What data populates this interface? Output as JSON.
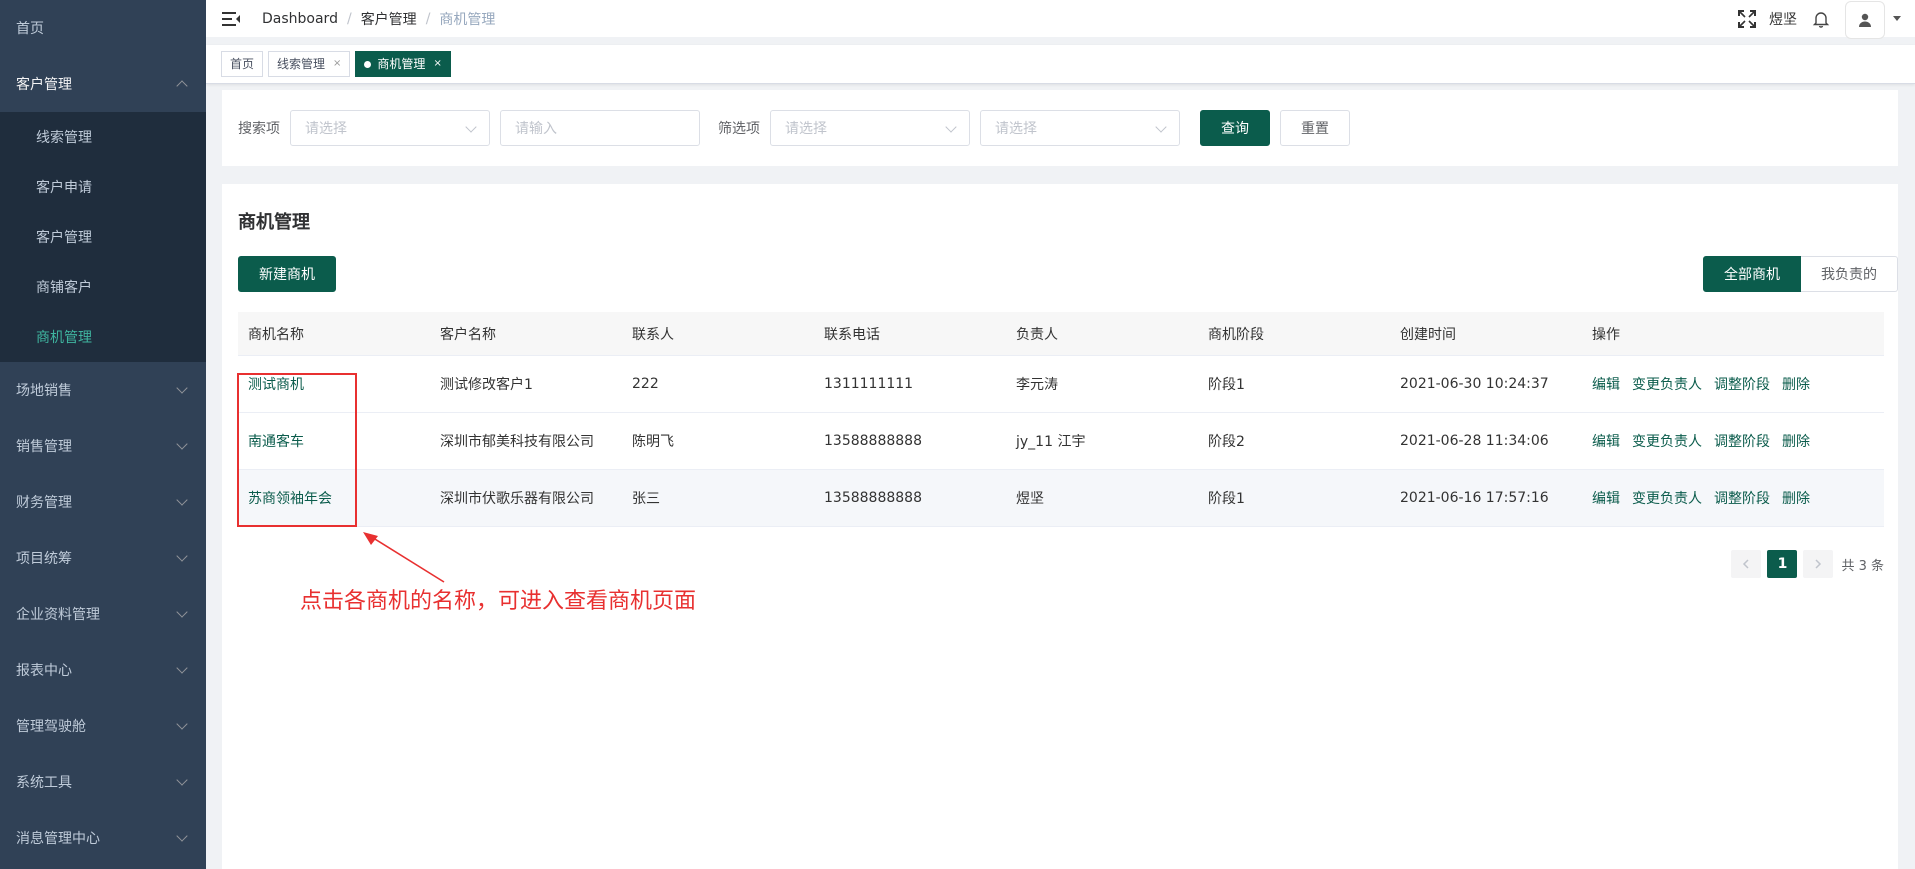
{
  "sidebar": {
    "items": [
      {
        "label": "首页"
      },
      {
        "label": "客户管理"
      },
      {
        "label": "场地销售"
      },
      {
        "label": "销售管理"
      },
      {
        "label": "财务管理"
      },
      {
        "label": "项目统筹"
      },
      {
        "label": "企业资料管理"
      },
      {
        "label": "报表中心"
      },
      {
        "label": "管理驾驶舱"
      },
      {
        "label": "系统工具"
      },
      {
        "label": "消息管理中心"
      }
    ],
    "sub_items": [
      {
        "label": "线索管理"
      },
      {
        "label": "客户申请"
      },
      {
        "label": "客户管理"
      },
      {
        "label": "商铺客户"
      },
      {
        "label": "商机管理"
      }
    ]
  },
  "navbar": {
    "breadcrumb": [
      "Dashboard",
      "客户管理",
      "商机管理"
    ],
    "user_name": "煜坚"
  },
  "tags": {
    "home": "首页",
    "leads": "线索管理",
    "opportunity": "商机管理",
    "close": "×"
  },
  "search": {
    "search_label": "搜索项",
    "search_select_placeholder": "请选择",
    "search_input_placeholder": "请输入",
    "filter_label": "筛选项",
    "filter_select1_placeholder": "请选择",
    "filter_select2_placeholder": "请选择",
    "query_button": "查询",
    "reset_button": "重置"
  },
  "main": {
    "title": "商机管理",
    "new_button": "新建商机",
    "toggle_all": "全部商机",
    "toggle_mine": "我负责的"
  },
  "table": {
    "headers": [
      "商机名称",
      "客户名称",
      "联系人",
      "联系电话",
      "负责人",
      "商机阶段",
      "创建时间",
      "操作"
    ],
    "rows": [
      {
        "name": "测试商机",
        "customer": "测试修改客户1",
        "contact": "222",
        "phone": "1311111111",
        "owner": "李元涛",
        "stage": "阶段1",
        "created": "2021-06-30 10:24:37"
      },
      {
        "name": "南通客车",
        "customer": "深圳市郁美科技有限公司",
        "contact": "陈明飞",
        "phone": "13588888888",
        "owner": "jy_11 江宇",
        "stage": "阶段2",
        "created": "2021-06-28 11:34:06"
      },
      {
        "name": "苏商领袖年会",
        "customer": "深圳市伏歌乐器有限公司",
        "contact": "张三",
        "phone": "13588888888",
        "owner": "煜坚",
        "stage": "阶段1",
        "created": "2021-06-16 17:57:16"
      }
    ],
    "ops": [
      "编辑",
      "变更负责人",
      "调整阶段",
      "删除"
    ]
  },
  "pagination": {
    "current_page": "1",
    "total_text": "共 3 条"
  },
  "annotation": {
    "text": "点击各商机的名称，可进入查看商机页面"
  },
  "colors": {
    "primary": "#0b5c4c",
    "sidebar_bg": "#304156",
    "submenu_bg": "#1f2d3d",
    "annotation": "#e83030"
  }
}
